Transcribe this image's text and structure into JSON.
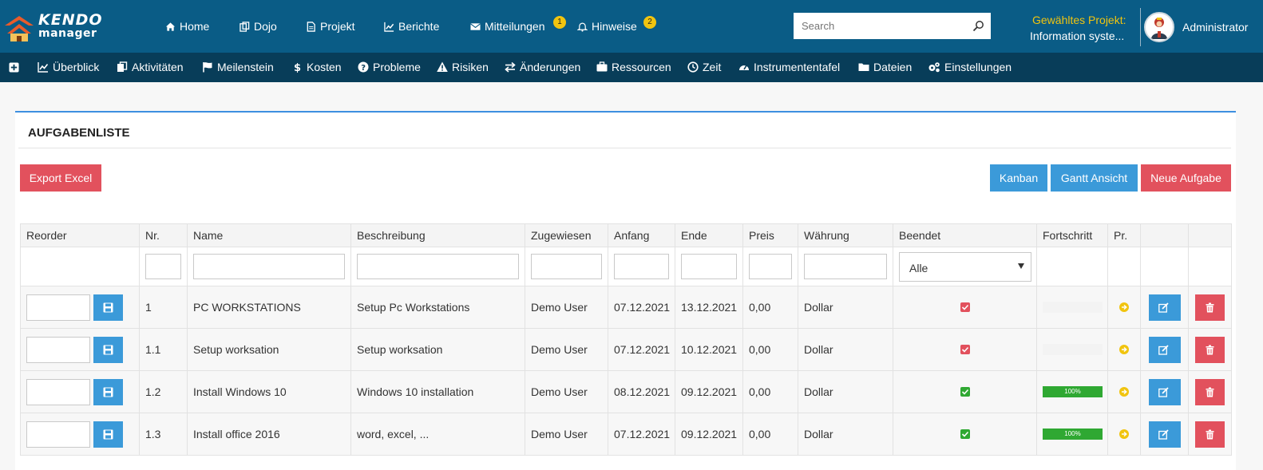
{
  "brand": {
    "line1": "KENDO",
    "line2": "manager"
  },
  "topnav": [
    {
      "label": "Home",
      "icon": "home-icon"
    },
    {
      "label": "Dojo",
      "icon": "copy-icon"
    },
    {
      "label": "Projekt",
      "icon": "file-icon"
    },
    {
      "label": "Berichte",
      "icon": "line-chart-icon"
    },
    {
      "label": "Mitteilungen",
      "icon": "envelope-icon",
      "badge": "1"
    },
    {
      "label": "Hinweise",
      "icon": "bell-icon",
      "badge": "2"
    }
  ],
  "search": {
    "placeholder": "Search",
    "value": ""
  },
  "project": {
    "label": "Gewähltes Projekt:",
    "value": "Information syste..."
  },
  "user": {
    "name": "Administrator"
  },
  "subnav": [
    {
      "label": "",
      "icon": "plus-icon"
    },
    {
      "label": "Überblick",
      "icon": "line-chart-icon"
    },
    {
      "label": "Aktivitäten",
      "icon": "files-icon"
    },
    {
      "label": "Meilenstein",
      "icon": "flag-icon"
    },
    {
      "label": "Kosten",
      "icon": "dollar-icon"
    },
    {
      "label": "Probleme",
      "icon": "question-icon"
    },
    {
      "label": "Risiken",
      "icon": "warning-icon"
    },
    {
      "label": "Änderungen",
      "icon": "exchange-icon"
    },
    {
      "label": "Ressourcen",
      "icon": "briefcase-icon"
    },
    {
      "label": "Zeit",
      "icon": "clock-icon"
    },
    {
      "label": "Instrumententafel",
      "icon": "dashboard-icon"
    },
    {
      "label": "Dateien",
      "icon": "folder-icon"
    },
    {
      "label": "Einstellungen",
      "icon": "cogs-icon"
    }
  ],
  "panel": {
    "title": "AUFGABENLISTE",
    "export_label": "Export Excel",
    "kanban_label": "Kanban",
    "gantt_label": "Gantt Ansicht",
    "new_label": "Neue Aufgabe"
  },
  "table": {
    "headers": [
      "Reorder",
      "Nr.",
      "Name",
      "Beschreibung",
      "Zugewiesen",
      "Anfang",
      "Ende",
      "Preis",
      "Währung",
      "Beendet",
      "Fortschritt",
      "Pr.",
      "",
      ""
    ],
    "beendet_filter": "Alle",
    "rows": [
      {
        "nr": "1",
        "name": "PC WORKSTATIONS",
        "desc": "Setup Pc Workstations",
        "assigned": "Demo User",
        "start": "07.12.2021",
        "end": "13.12.2021",
        "price": "0,00",
        "currency": "Dollar",
        "done": false,
        "progress": 0,
        "progress_label": ""
      },
      {
        "nr": "1.1",
        "name": "Setup worksation",
        "desc": "Setup worksation",
        "assigned": "Demo User",
        "start": "07.12.2021",
        "end": "10.12.2021",
        "price": "0,00",
        "currency": "Dollar",
        "done": false,
        "progress": 0,
        "progress_label": ""
      },
      {
        "nr": "1.2",
        "name": "Install Windows 10",
        "desc": "Windows 10 installation",
        "assigned": "Demo User",
        "start": "08.12.2021",
        "end": "09.12.2021",
        "price": "0,00",
        "currency": "Dollar",
        "done": true,
        "progress": 100,
        "progress_label": "100%"
      },
      {
        "nr": "1.3",
        "name": "Install office 2016",
        "desc": "word, excel, ...",
        "assigned": "Demo User",
        "start": "07.12.2021",
        "end": "09.12.2021",
        "price": "0,00",
        "currency": "Dollar",
        "done": true,
        "progress": 100,
        "progress_label": "100%"
      }
    ]
  },
  "colors": {
    "topbar": "#0a5c86",
    "subbar": "#083d59",
    "accent_blue": "#3b9ad9",
    "accent_red": "#e2515d",
    "badge": "#f1c40f",
    "progress": "#2fa832"
  }
}
